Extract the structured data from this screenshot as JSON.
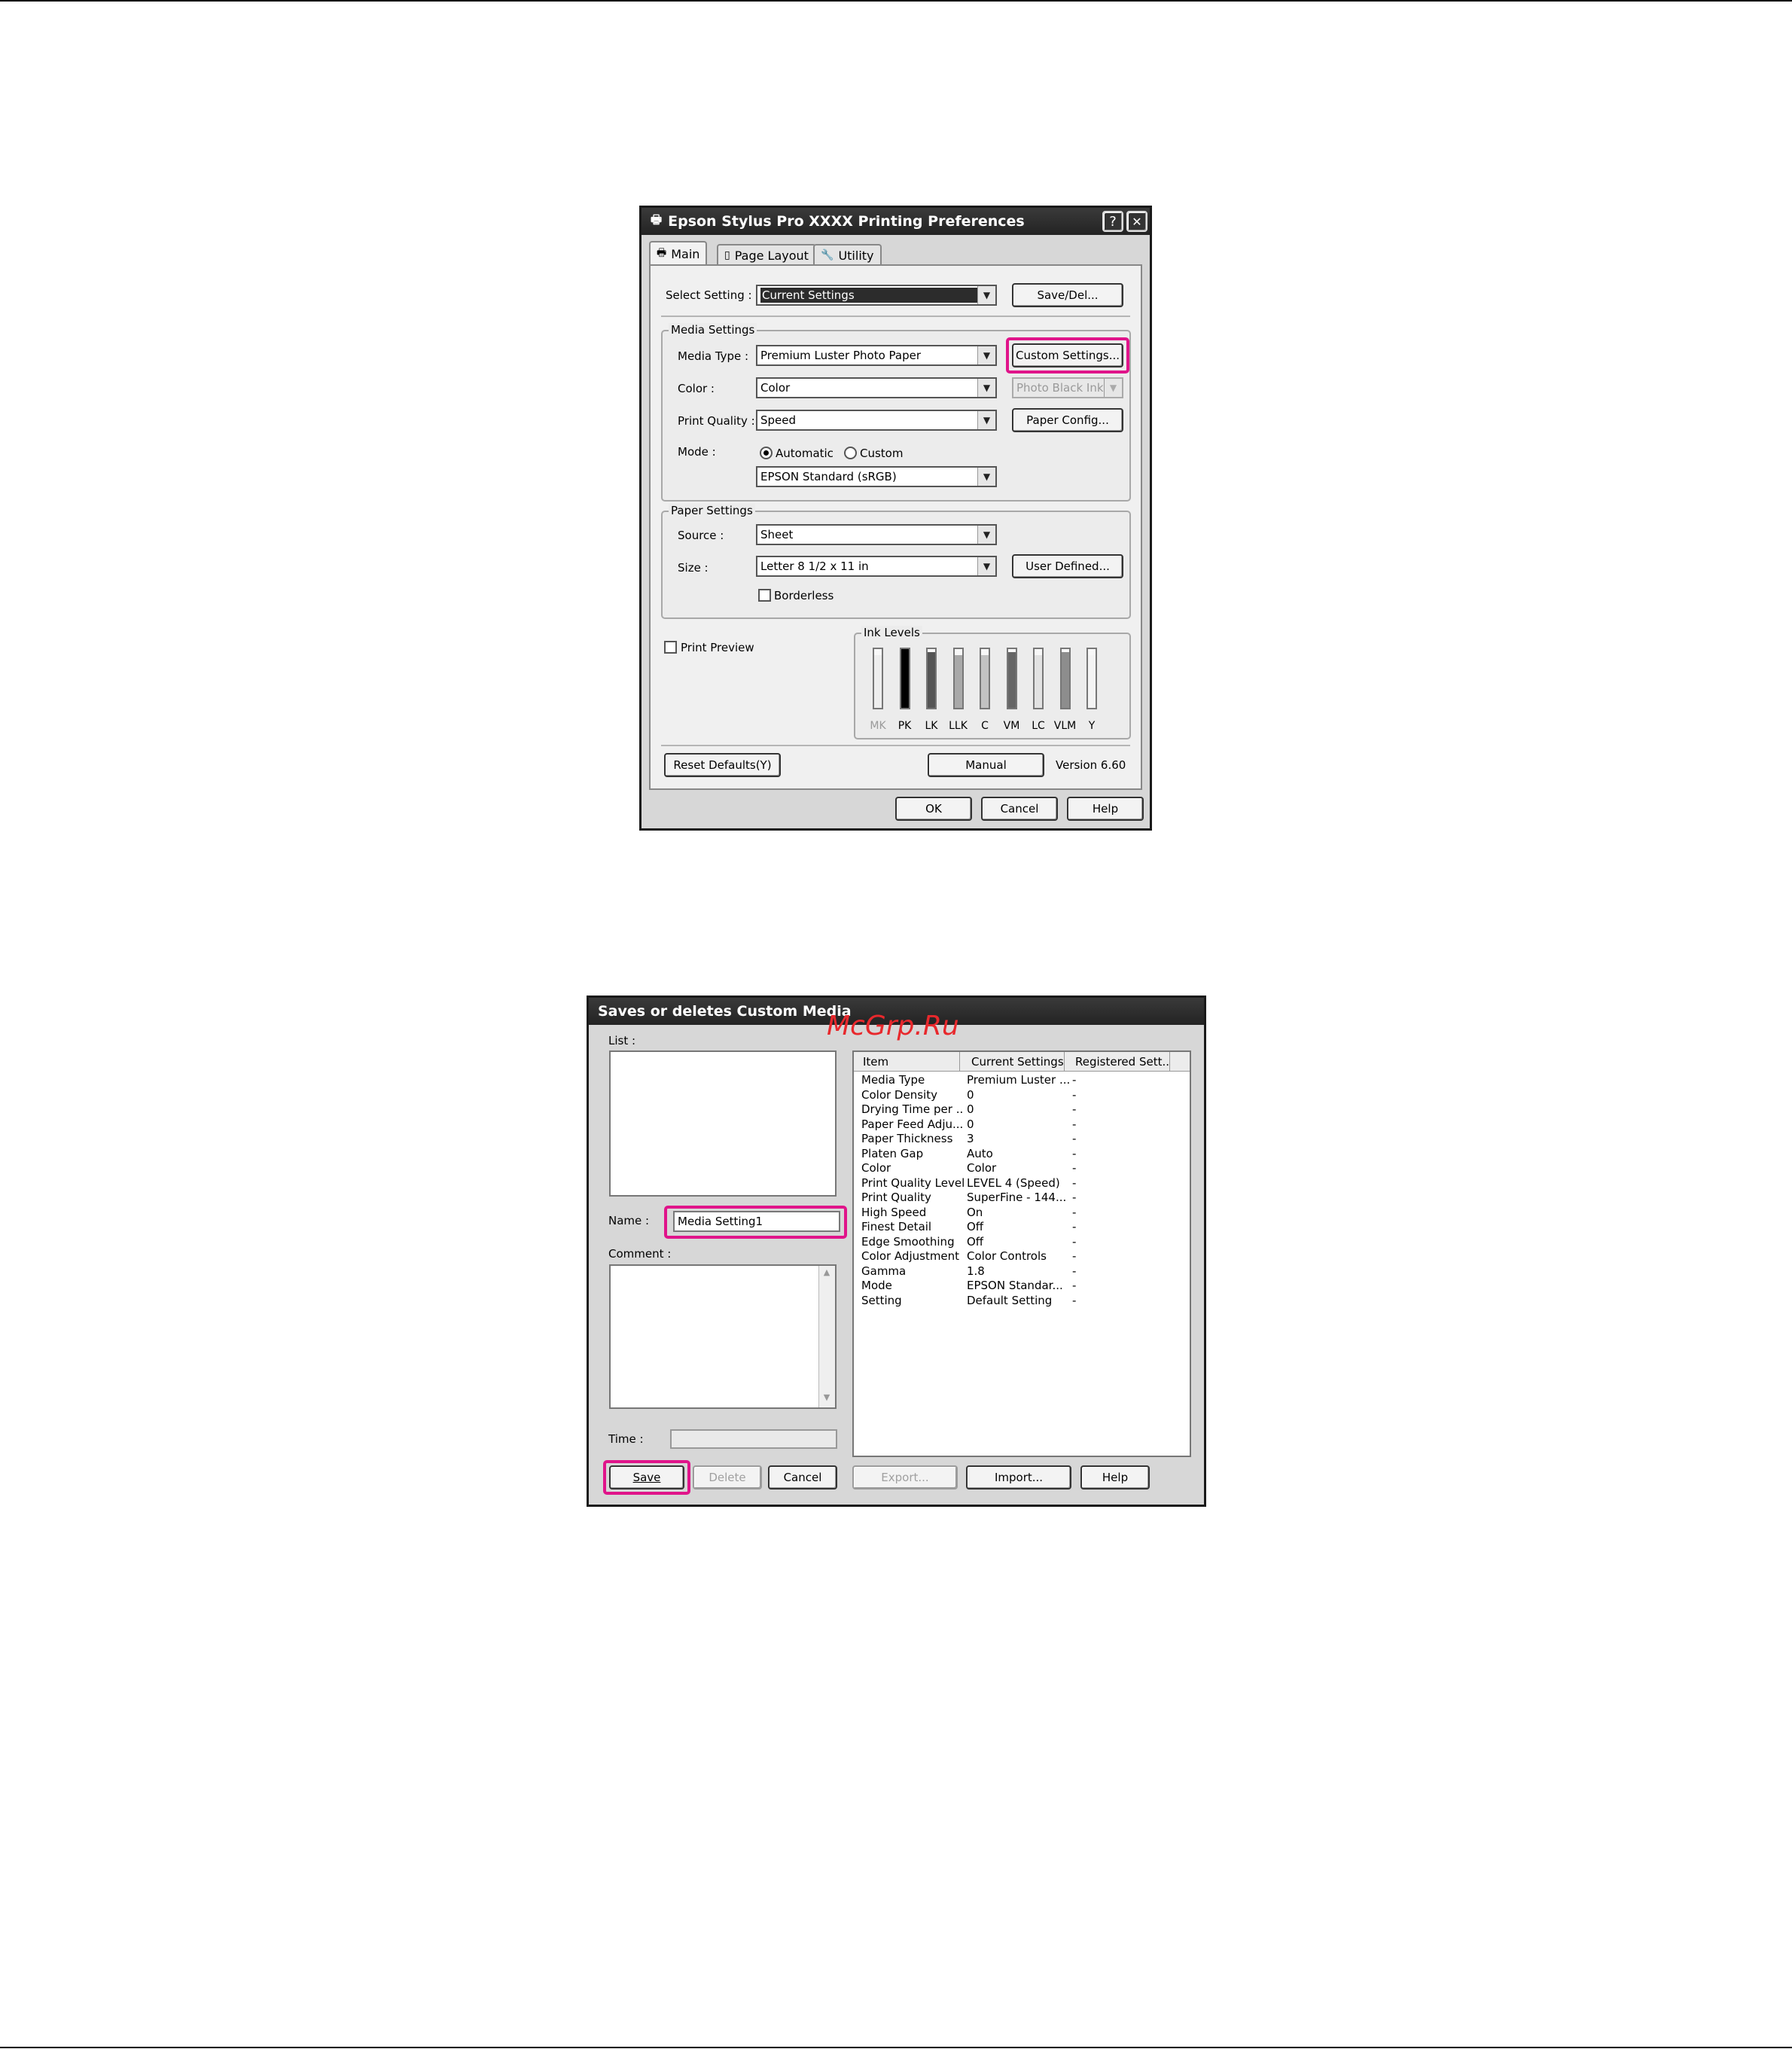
{
  "watermark": "McGrp.Ru",
  "prefs": {
    "title": "Epson Stylus Pro XXXX Printing Preferences",
    "help_glyph": "?",
    "close_glyph": "✕",
    "tabs": [
      {
        "label": "Main",
        "icon": "printer-icon"
      },
      {
        "label": "Page Layout",
        "icon": "page-icon"
      },
      {
        "label": "Utility",
        "icon": "wrench-icon"
      }
    ],
    "select_setting": {
      "label": "Select Setting :",
      "value": "Current Settings"
    },
    "save_del": "Save/Del...",
    "media_settings": {
      "title": "Media Settings",
      "media_type": {
        "label": "Media Type :",
        "value": "Premium Luster Photo Paper"
      },
      "custom_settings": "Custom Settings...",
      "color": {
        "label": "Color :",
        "value": "Color"
      },
      "black_ink": "Photo Black Ink",
      "print_quality": {
        "label": "Print Quality :",
        "value": "Speed"
      },
      "paper_config": "Paper Config...",
      "mode": {
        "label": "Mode :",
        "automatic": "Automatic",
        "custom": "Custom",
        "selected": "Automatic",
        "value": "EPSON Standard (sRGB)"
      }
    },
    "paper_settings": {
      "title": "Paper Settings",
      "source": {
        "label": "Source :",
        "value": "Sheet"
      },
      "size": {
        "label": "Size :",
        "value": "Letter 8 1/2 x 11 in"
      },
      "user_defined": "User Defined...",
      "borderless": "Borderless",
      "borderless_checked": false
    },
    "print_preview": "Print Preview",
    "print_preview_checked": false,
    "ink_levels": {
      "title": "Ink Levels",
      "inks": [
        {
          "name": "MK",
          "level": 0.9,
          "color": "#eeeeee",
          "dimmed": true
        },
        {
          "name": "PK",
          "level": 1.0,
          "color": "#000000",
          "dimmed": false
        },
        {
          "name": "LK",
          "level": 0.95,
          "color": "#555555",
          "dimmed": false
        },
        {
          "name": "LLK",
          "level": 0.9,
          "color": "#a9a9a9",
          "dimmed": false
        },
        {
          "name": "C",
          "level": 0.9,
          "color": "#c2c2c2",
          "dimmed": false
        },
        {
          "name": "VM",
          "level": 0.95,
          "color": "#666666",
          "dimmed": false
        },
        {
          "name": "LC",
          "level": 0.9,
          "color": "#e2e2e2",
          "dimmed": false
        },
        {
          "name": "VLM",
          "level": 0.95,
          "color": "#8d8d8d",
          "dimmed": false
        },
        {
          "name": "Y",
          "level": 0.9,
          "color": "#f4f4f4",
          "dimmed": false
        }
      ]
    },
    "reset_defaults": "Reset Defaults(Y)",
    "manual": "Manual",
    "version": "Version 6.60",
    "ok": "OK",
    "cancel": "Cancel",
    "help": "Help"
  },
  "custom": {
    "title": "Saves or deletes Custom Media",
    "list_label": "List :",
    "name_label": "Name :",
    "name_value": "Media Setting1",
    "comment_label": "Comment :",
    "time_label": "Time :",
    "columns": [
      "Item",
      "Current Settings",
      "Registered Sett..."
    ],
    "rows": [
      [
        "Media Type",
        "Premium Luster ...",
        "-"
      ],
      [
        "Color Density",
        "0",
        "-"
      ],
      [
        "Drying Time per ...",
        "0",
        "-"
      ],
      [
        "Paper Feed Adju...",
        "0",
        "-"
      ],
      [
        "Paper Thickness",
        "3",
        "-"
      ],
      [
        "Platen Gap",
        "Auto",
        "-"
      ],
      [
        "Color",
        "Color",
        "-"
      ],
      [
        "Print Quality Level",
        "LEVEL 4 (Speed)",
        "-"
      ],
      [
        "Print Quality",
        "SuperFine - 144...",
        "-"
      ],
      [
        "High Speed",
        "On",
        "-"
      ],
      [
        "Finest Detail",
        "Off",
        "-"
      ],
      [
        "Edge Smoothing",
        "Off",
        "-"
      ],
      [
        "Color Adjustment",
        "Color Controls",
        "-"
      ],
      [
        "Gamma",
        "1.8",
        "-"
      ],
      [
        "Mode",
        "EPSON Standar...",
        "-"
      ],
      [
        "Setting",
        "Default Setting",
        "-"
      ]
    ],
    "save": "Save",
    "delete": "Delete",
    "cancel": "Cancel",
    "export": "Export...",
    "import": "Import...",
    "help": "Help"
  },
  "colors": {
    "highlight": "#e0148a",
    "watermark": "#e8282c"
  }
}
